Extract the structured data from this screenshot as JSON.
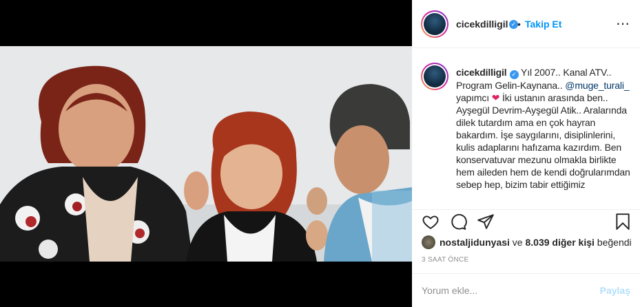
{
  "post": {
    "username": "cicekdilligil",
    "dot": "•",
    "follow_label": "Takip Et",
    "more_icon": "⋯"
  },
  "caption": {
    "username": "cicekdilligil",
    "text_1": " Yıl 2007.. Kanal ATV.. Program Gelin-Kaynana.. ",
    "mention": "@muge_turali_",
    "text_2": " yapımcı ",
    "heart": "❤",
    "text_3": " İki ustanın arasında ben.. Ayşegül Devrim-Ayşegül Atik.. Aralarında dilek tutardım ama en çok hayran bakardım. İşe saygılarını, disiplinlerini, kulis adaplarını hafızama kazırdım. Ben konservatuvar mezunu olmakla birlikte hem aileden hem de kendi doğrularımdan sebep hep, bizim tabir ettiğimiz"
  },
  "actions": {
    "like_icon": "heart-outline",
    "comment_icon": "speech-bubble",
    "share_icon": "paper-plane",
    "save_icon": "bookmark"
  },
  "likes": {
    "liker": "nostaljidunyasi",
    "connector": " ve ",
    "count_text": "8.039 diğer kişi",
    "suffix": " beğendi"
  },
  "time": "3 SAAT ÖNCE",
  "comment": {
    "placeholder": "Yorum ekle...",
    "share_label": "Paylaş"
  },
  "colors": {
    "accent": "#0095f6",
    "link": "#00376b",
    "muted": "#8e8e8e",
    "share_disabled": "#b2dffc",
    "heart": "#e0245e"
  }
}
